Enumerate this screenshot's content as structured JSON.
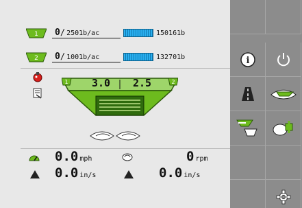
{
  "product1": {
    "badge": "1",
    "current": "0",
    "target": "2501b/ac",
    "amount": "150161b"
  },
  "product2": {
    "badge": "2",
    "current": "0",
    "target": "1001b/ac",
    "amount": "132701b"
  },
  "meter": {
    "left_badge": "1",
    "right_badge": "2",
    "left_value": "3.0",
    "right_value": "2.5"
  },
  "stats": {
    "speed_value": "0.0",
    "speed_unit": "mph",
    "rpm_value": "0",
    "rpm_unit": "rpm",
    "depth_left_value": "0.0",
    "depth_left_unit": "in/s",
    "depth_right_value": "0.0",
    "depth_right_unit": "in/s"
  },
  "colors": {
    "accent_green": "#6dbb1e",
    "bar_blue": "#1fa0e0",
    "panel_gray": "#8c8c8c"
  },
  "buttons": {
    "info": "info-icon",
    "power": "power-icon",
    "road": "road-icon",
    "implement": "implement-icon",
    "funnel": "funnel-icon",
    "fill": "fill-tank-icon",
    "settings": "gear-icon"
  }
}
